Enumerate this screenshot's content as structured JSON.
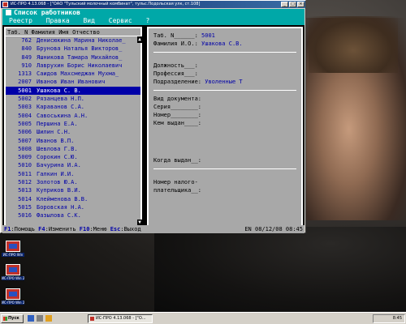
{
  "window": {
    "title": "ИС-ПРО 4.13.068 - [\"ОАО \"Тульский молочный комбинат\", тульс.Подольская улк, ст.108]",
    "minimize": "_",
    "maximize": "□",
    "close": "×"
  },
  "console": {
    "header_title": "Список работников",
    "menu": [
      "Реестр",
      "Правка",
      "Вид",
      "Сервис",
      "?"
    ]
  },
  "list": {
    "header": "Таб. N  Фамилия Имя Отчество",
    "rows": [
      {
        "num": "762",
        "name": "Денисюкина Марина Николае_"
      },
      {
        "num": "840",
        "name": "Брунова Наталья Викторов_"
      },
      {
        "num": "849",
        "name": "Яшникова Тамара Михайлов_"
      },
      {
        "num": "910",
        "name": "Лаврухин Борис Николаевич"
      },
      {
        "num": "1313",
        "name": "Саидов Махсмеджан Мухма_"
      },
      {
        "num": "2007",
        "name": "Иванов Иван Иванович"
      },
      {
        "num": "5001",
        "name": "Ушакова С. В."
      },
      {
        "num": "5002",
        "name": "Рязанцева Н.П."
      },
      {
        "num": "5003",
        "name": "Караванов С.А."
      },
      {
        "num": "5004",
        "name": "Савоськина А.Н."
      },
      {
        "num": "5005",
        "name": "Першина Е.А."
      },
      {
        "num": "5006",
        "name": "Шилин  С.Н."
      },
      {
        "num": "5007",
        "name": "Иванов В.П."
      },
      {
        "num": "5008",
        "name": "Шевлова Г.В."
      },
      {
        "num": "5009",
        "name": "Сорокин С.Ю."
      },
      {
        "num": "5010",
        "name": "Бачурина И.А."
      },
      {
        "num": "5011",
        "name": "Галкин И.И."
      },
      {
        "num": "5012",
        "name": "Золотов Ю.А."
      },
      {
        "num": "5013",
        "name": "Куприков В.И."
      },
      {
        "num": "5014",
        "name": "Клейменова В.В."
      },
      {
        "num": "5015",
        "name": "Боровская Н.А."
      },
      {
        "num": "5016",
        "name": "Фазылова С.К."
      }
    ],
    "selected_index": 6
  },
  "detail": {
    "tab_label": "Таб. N______:",
    "tab_value": "5001",
    "fio_label": "Фамилия И.О.:",
    "fio_value": "Ушакова С.В.",
    "position_label": "Должность___:",
    "profession_label": "Профессия___:",
    "division_label": "Подразделение:",
    "division_value": "Уволенные Т",
    "doc_type_label": "Вид документа:",
    "series_label": "Серия________:",
    "number_label": "Номер________:",
    "issued_by_label": "Кем выдан____:",
    "issue_date_label": "Когда выдан__:",
    "tax_label_1": "Номер налого-",
    "tax_label_2": "плательщика__:"
  },
  "fkeys": {
    "f1_key": "F1",
    "f1_label": ":Помощь",
    "f4_key": "F4",
    "f4_label": ":Изменить",
    "f10_key": "F10",
    "f10_label": ":Меню",
    "esc_key": "Esc",
    "esc_label": ":Выход",
    "status": "EN 08/12/08 08:45"
  },
  "desktop_icons": [
    {
      "label": "ИС-ПРО Win",
      "icon": "app-icon"
    },
    {
      "label": "ИС-ПРО Win 2007",
      "icon": "app-icon"
    },
    {
      "label": "ИС-ПРО Win 2008",
      "icon": "app-icon"
    }
  ],
  "taskbar": {
    "start": "Пуск",
    "task": "ИС-ПРО 4.13.068 - [\"О...",
    "clock": "8:45"
  },
  "colors": {
    "title_cyan": "#00a8a8",
    "panel_gray": "#a8a8a8",
    "text_blue": "#0000a8",
    "selected_bg": "#0000a8"
  }
}
